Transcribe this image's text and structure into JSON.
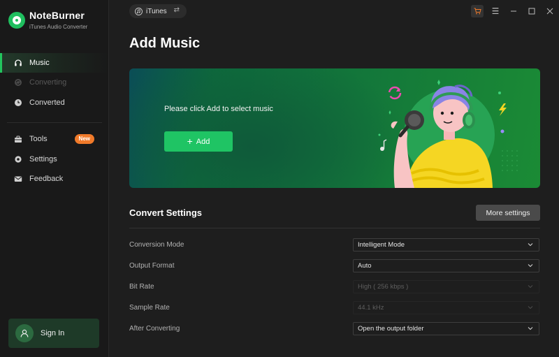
{
  "app": {
    "name": "NoteBurner",
    "subtitle": "iTunes Audio Converter"
  },
  "sidebar": {
    "items": [
      {
        "label": "Music",
        "icon": "headphones-icon",
        "state": "active"
      },
      {
        "label": "Converting",
        "icon": "sync-icon",
        "state": "disabled"
      },
      {
        "label": "Converted",
        "icon": "clock-icon",
        "state": "normal"
      },
      {
        "label": "Tools",
        "icon": "toolbox-icon",
        "state": "normal",
        "badge": "New"
      },
      {
        "label": "Settings",
        "icon": "gear-icon",
        "state": "normal"
      },
      {
        "label": "Feedback",
        "icon": "mail-icon",
        "state": "normal"
      }
    ],
    "sign_in": "Sign In"
  },
  "topbar": {
    "source": "iTunes",
    "swap_icon": "swap-icon"
  },
  "main": {
    "title": "Add Music",
    "banner": {
      "text": "Please click Add to select music",
      "add_label": "Add"
    },
    "convert_settings": {
      "title": "Convert Settings",
      "more_label": "More settings",
      "rows": [
        {
          "label": "Conversion Mode",
          "value": "Intelligent Mode",
          "enabled": true
        },
        {
          "label": "Output Format",
          "value": "Auto",
          "enabled": true
        },
        {
          "label": "Bit Rate",
          "value": "High ( 256 kbps )",
          "enabled": false
        },
        {
          "label": "Sample Rate",
          "value": "44.1 kHz",
          "enabled": false
        },
        {
          "label": "After Converting",
          "value": "Open the output folder",
          "enabled": true
        }
      ]
    }
  },
  "colors": {
    "accent": "#1fc464",
    "badge": "#f07a2a",
    "background": "#1e1e1e",
    "sidebar": "#191919"
  }
}
